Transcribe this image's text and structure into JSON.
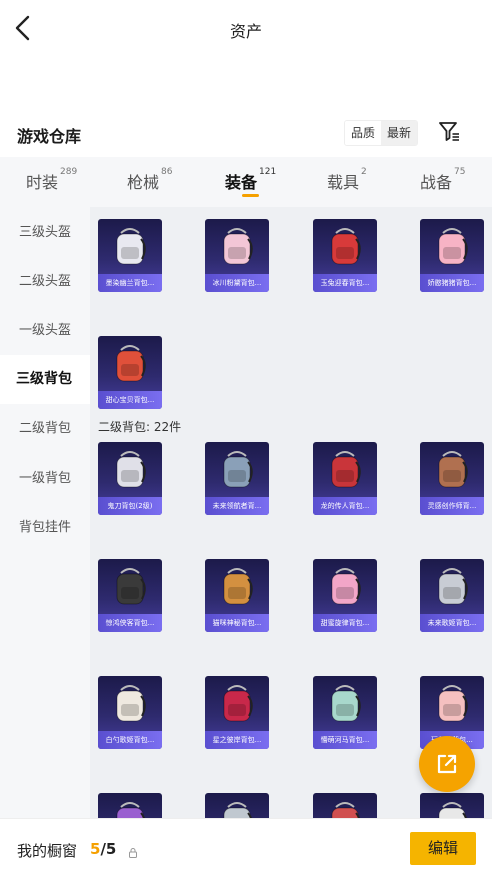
{
  "header": {
    "title": "资产"
  },
  "section": {
    "title": "游戏仓库",
    "sort": [
      "品质",
      "最新"
    ]
  },
  "tabs": [
    {
      "label": "时装",
      "count": "289"
    },
    {
      "label": "枪械",
      "count": "86"
    },
    {
      "label": "装备",
      "count": "121"
    },
    {
      "label": "载具",
      "count": "2"
    },
    {
      "label": "战备",
      "count": "75"
    }
  ],
  "sidebar": [
    {
      "label": "三级头盔"
    },
    {
      "label": "二级头盔"
    },
    {
      "label": "一级头盔"
    },
    {
      "label": "三级背包"
    },
    {
      "label": "二级背包"
    },
    {
      "label": "一级背包"
    },
    {
      "label": "背包挂件"
    }
  ],
  "group1": [
    {
      "name": "墨染幽兰背包...",
      "color": "#e8e8f0"
    },
    {
      "name": "冰川粉黛背包...",
      "color": "#f3c6d6"
    },
    {
      "name": "玉兔迎春背包...",
      "color": "#d83a3a"
    },
    {
      "name": "娇憨猪猪背包...",
      "color": "#f7b3c5"
    },
    {
      "name": "甜心宝贝背包...",
      "color": "#e0503a"
    }
  ],
  "group2_label": "二级背包: 22件",
  "group2": [
    {
      "name": "鬼刀背包(2级)",
      "color": "#e0e0e8"
    },
    {
      "name": "未来领航者背...",
      "color": "#8aa0b8"
    },
    {
      "name": "龙的传人背包...",
      "color": "#c9353a"
    },
    {
      "name": "灵感创作师背...",
      "color": "#b07050"
    },
    {
      "name": "惊鸿侠客背包...",
      "color": "#3a3a3a"
    },
    {
      "name": "猫咪神秘背包...",
      "color": "#d39040"
    },
    {
      "name": "甜蜜旋律背包...",
      "color": "#f2a6c8"
    },
    {
      "name": "未来歌姬背包...",
      "color": "#c8ccd4"
    },
    {
      "name": "白勺歌姬背包...",
      "color": "#efe9e0"
    },
    {
      "name": "星之彼岸背包...",
      "color": "#c8284a"
    },
    {
      "name": "懵萌河马背包...",
      "color": "#a8d8cc"
    },
    {
      "name": "玩偶熊背包...",
      "color": "#f5c0c0"
    },
    {
      "name": "",
      "color": "#9a60d0"
    },
    {
      "name": "",
      "color": "#c0c8d0"
    },
    {
      "name": "",
      "color": "#d05050"
    },
    {
      "name": "",
      "color": "#e8e8e8"
    }
  ],
  "bottom": {
    "title": "我的橱窗",
    "current": "5",
    "total": "/5",
    "edit_label": "编辑"
  }
}
